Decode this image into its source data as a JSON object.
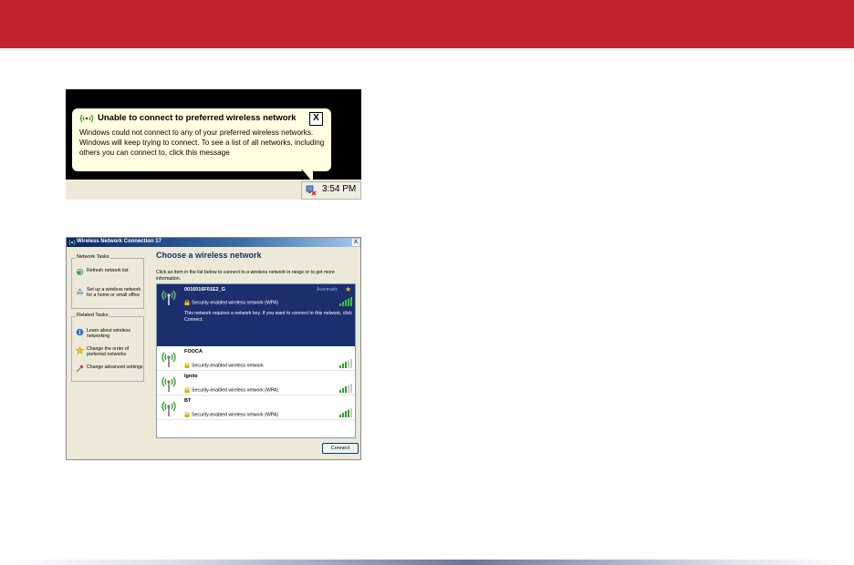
{
  "balloon": {
    "title": "Unable to connect to preferred wireless network",
    "close_label": "X",
    "message": "Windows could not connect to any of your preferred wireless networks. Windows will keep trying to connect. To see a list of all networks, including others you can connect to, click this message",
    "clock": "3:54 PM"
  },
  "dialog": {
    "title": "Wireless Network Connection 17",
    "close_label": "X",
    "heading": "Choose a wireless network",
    "instruction": "Click an item in the list below to connect to a wireless network in range or to get more information.",
    "network_tasks": {
      "title": "Network Tasks",
      "items": [
        {
          "label": "Refresh network list",
          "icon": "refresh-icon"
        },
        {
          "label": "Set up a wireless network for a home or small office",
          "icon": "setup-network-icon"
        }
      ]
    },
    "related_tasks": {
      "title": "Related Tasks",
      "items": [
        {
          "label": "Learn about wireless networking",
          "icon": "info-icon"
        },
        {
          "label": "Change the order of preferred networks",
          "icon": "star-icon"
        },
        {
          "label": "Change advanced settings",
          "icon": "settings-icon"
        }
      ]
    },
    "networks": [
      {
        "name": "0016016F01E2_G",
        "security": "Security-enabled wireless network (WPA)",
        "status": "Automatic",
        "description": "This network requires a network key. If you want to connect to this network, click Connect.",
        "selected": true
      },
      {
        "name": "FOOCA",
        "security": "Security-enabled wireless network"
      },
      {
        "name": "Ignite",
        "security": "Security-enabled wireless network (WPA)"
      },
      {
        "name": "BT",
        "security": "Security-enabled wireless network (WPA)"
      }
    ],
    "connect_label": "Connect"
  },
  "colors": {
    "header_red": "#c0222e",
    "balloon_bg": "#ffffe1",
    "selected_row": "#1c2e6e",
    "signal_green": "#2aa12a",
    "heading_blue": "#1a2f66"
  }
}
